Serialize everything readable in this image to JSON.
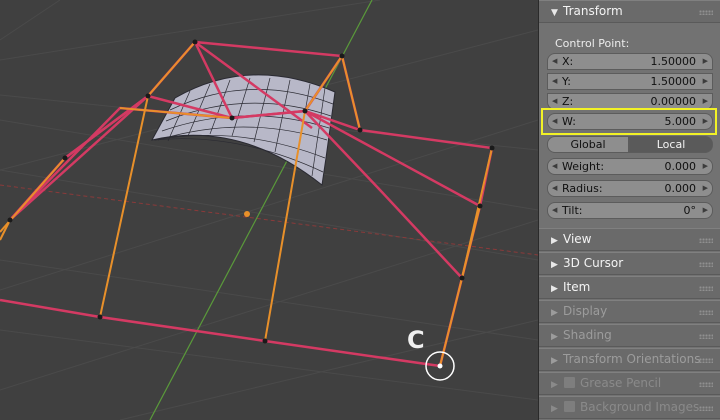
{
  "panel": {
    "transform": {
      "title": "Transform",
      "control_point_label": "Control Point:",
      "fields": [
        {
          "label": "X:",
          "value": "1.50000"
        },
        {
          "label": "Y:",
          "value": "1.50000"
        },
        {
          "label": "Z:",
          "value": "0.00000"
        }
      ],
      "w": {
        "label": "W:",
        "value": "5.000"
      },
      "space_options": [
        "Global",
        "Local"
      ],
      "space_selected": "Local",
      "weight": {
        "label": "Weight:",
        "value": "0.000"
      },
      "radius": {
        "label": "Radius:",
        "value": "0.000"
      },
      "tilt": {
        "label": "Tilt:",
        "value": "0°"
      }
    },
    "sections": [
      {
        "title": "View",
        "state": "normal"
      },
      {
        "title": "3D Cursor",
        "state": "normal"
      },
      {
        "title": "Item",
        "state": "normal"
      },
      {
        "title": "Display",
        "state": "dim"
      },
      {
        "title": "Shading",
        "state": "dim"
      },
      {
        "title": "Transform Orientations",
        "state": "dim"
      },
      {
        "title": "Grease Pencil",
        "state": "faint",
        "checkbox": true
      },
      {
        "title": "Background Images",
        "state": "faint",
        "checkbox": true
      }
    ]
  },
  "viewport": {
    "cursor_label": "C",
    "colors": {
      "background": "#404040",
      "grid": "#4a4a4a",
      "cage_edge": "#d43a63",
      "handle_edge": "#e8902a",
      "surface": "#b8b8c8",
      "x_axis": "#8a3a3a",
      "y_axis": "#5a9a3a"
    }
  }
}
